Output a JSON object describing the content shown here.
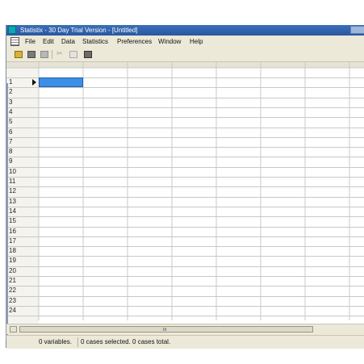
{
  "window": {
    "title": "Statistix - 30 Day Trial Version - [Untitled]"
  },
  "menu": {
    "items": [
      "File",
      "Edit",
      "Data",
      "Statistics",
      "Preferences",
      "Window",
      "Help"
    ]
  },
  "toolbar": {
    "icons": [
      "open-folder-icon",
      "save-disk-icon",
      "print-icon",
      "cut-icon",
      "copy-icon",
      "paste-icon"
    ]
  },
  "grid": {
    "row_labels": [
      "1",
      "2",
      "3",
      "4",
      "5",
      "6",
      "7",
      "8",
      "9",
      "10",
      "11",
      "12",
      "13",
      "14",
      "15",
      "16",
      "17",
      "18",
      "19",
      "20",
      "21",
      "22",
      "23",
      "24"
    ],
    "active_cell": {
      "row": "1",
      "column": 1
    },
    "column_headers": []
  },
  "scrollbar": {
    "grip_glyph": "III"
  },
  "status": {
    "variables_text": "0 variables.",
    "cases_text": "0 cases selected. 0 cases total."
  },
  "colors": {
    "titlebar": "#2a57a0",
    "active_cell": "#3d8ee6",
    "chrome": "#ece9d8"
  }
}
